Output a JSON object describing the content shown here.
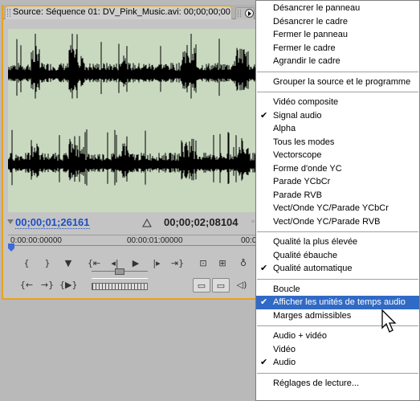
{
  "source_panel": {
    "tab_title": "Source: Séquence 01: DV_Pink_Music.avi: 00;00;00;00",
    "current_timecode": "00;00;01;26161",
    "duration_timecode": "00;00;02;08104",
    "ruler_labels": [
      "0:00:00:00000",
      "00:00:01:00000",
      "00:00"
    ],
    "colors": {
      "accent": "#e7a21f",
      "waveform_bg": "#c9d9c0",
      "timecode_blue": "#1f4fc4"
    }
  },
  "menu": {
    "items": [
      {
        "label": "Désancrer le panneau",
        "checked": false
      },
      {
        "label": "Désancrer le cadre",
        "checked": false
      },
      {
        "label": "Fermer le panneau",
        "checked": false
      },
      {
        "label": "Fermer le cadre",
        "checked": false
      },
      {
        "label": "Agrandir le cadre",
        "checked": false
      },
      {
        "label": "Grouper la source et le programme",
        "checked": false
      },
      {
        "label": "Vidéo composite",
        "checked": false
      },
      {
        "label": "Signal audio",
        "checked": true
      },
      {
        "label": "Alpha",
        "checked": false
      },
      {
        "label": "Tous les modes",
        "checked": false
      },
      {
        "label": "Vectorscope",
        "checked": false
      },
      {
        "label": "Forme d'onde YC",
        "checked": false
      },
      {
        "label": "Parade YCbCr",
        "checked": false
      },
      {
        "label": "Parade RVB",
        "checked": false
      },
      {
        "label": "Vect/Onde YC/Parade YCbCr",
        "checked": false
      },
      {
        "label": "Vect/Onde YC/Parade RVB",
        "checked": false
      },
      {
        "label": "Qualité la plus élevée",
        "checked": false
      },
      {
        "label": "Qualité ébauche",
        "checked": false
      },
      {
        "label": "Qualité automatique",
        "checked": true
      },
      {
        "label": "Boucle",
        "checked": false
      },
      {
        "label": "Afficher les unités de temps audio",
        "checked": true,
        "highlighted": true
      },
      {
        "label": "Marges admissibles",
        "checked": false
      },
      {
        "label": "Audio + vidéo",
        "checked": false
      },
      {
        "label": "Vidéo",
        "checked": false
      },
      {
        "label": "Audio",
        "checked": true
      },
      {
        "label": "Réglages de lecture...",
        "checked": false
      }
    ],
    "check_glyph": "✔",
    "highlight_color": "#316ac5"
  }
}
